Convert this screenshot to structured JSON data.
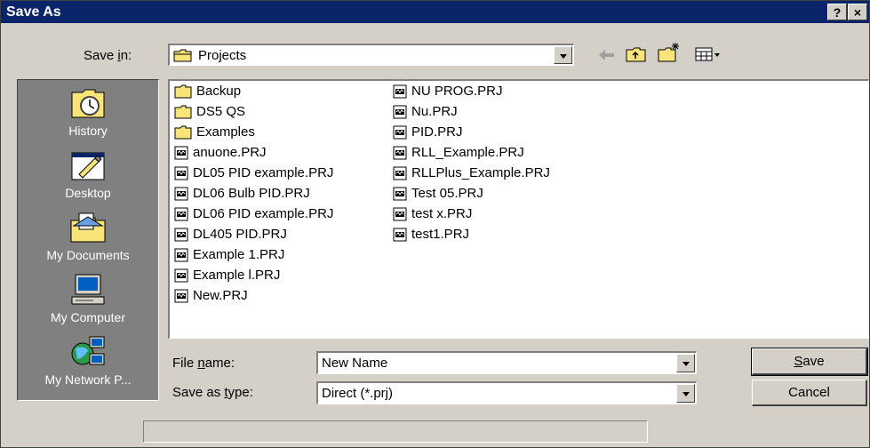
{
  "window": {
    "title": "Save As",
    "help_button": "?",
    "close_button": "×"
  },
  "save_in": {
    "label_pre": "Save ",
    "label_accel": "i",
    "label_post": "n:",
    "value": "Projects",
    "folder_icon": "folder-icon"
  },
  "toolbar": {
    "back_icon": "back-arrow-icon",
    "up_icon": "up-folder-icon",
    "new_folder_icon": "new-folder-icon",
    "view_menu_icon": "view-menu-icon"
  },
  "places": [
    {
      "label": "History",
      "icon": "history-icon"
    },
    {
      "label": "Desktop",
      "icon": "desktop-icon"
    },
    {
      "label": "My Documents",
      "icon": "my-documents-icon"
    },
    {
      "label": "My Computer",
      "icon": "my-computer-icon"
    },
    {
      "label": "My Network P...",
      "icon": "my-network-places-icon"
    }
  ],
  "files": {
    "col1": [
      {
        "name": "Backup",
        "type": "folder"
      },
      {
        "name": "DS5 QS",
        "type": "folder"
      },
      {
        "name": "Examples",
        "type": "folder"
      },
      {
        "name": "anuone.PRJ",
        "type": "prj"
      },
      {
        "name": "DL05 PID example.PRJ",
        "type": "prj"
      },
      {
        "name": "DL06 Bulb PID.PRJ",
        "type": "prj"
      },
      {
        "name": "DL06 PID example.PRJ",
        "type": "prj"
      },
      {
        "name": "DL405 PID.PRJ",
        "type": "prj"
      },
      {
        "name": "Example 1.PRJ",
        "type": "prj"
      },
      {
        "name": "Example l.PRJ",
        "type": "prj"
      },
      {
        "name": "New.PRJ",
        "type": "prj"
      }
    ],
    "col2": [
      {
        "name": "NU PROG.PRJ",
        "type": "prj"
      },
      {
        "name": "Nu.PRJ",
        "type": "prj"
      },
      {
        "name": "PID.PRJ",
        "type": "prj"
      },
      {
        "name": "RLL_Example.PRJ",
        "type": "prj"
      },
      {
        "name": "RLLPlus_Example.PRJ",
        "type": "prj"
      },
      {
        "name": "Test 05.PRJ",
        "type": "prj"
      },
      {
        "name": "test x.PRJ",
        "type": "prj"
      },
      {
        "name": "test1.PRJ",
        "type": "prj"
      }
    ]
  },
  "file_name": {
    "label_pre": "File ",
    "label_accel": "n",
    "label_post": "ame:",
    "value": "New Name"
  },
  "save_as_type": {
    "label_pre": "Save as ",
    "label_accel": "t",
    "label_post": "ype:",
    "value": "Direct (*.prj)"
  },
  "buttons": {
    "save_accel": "S",
    "save_rest": "ave",
    "cancel": "Cancel"
  },
  "colors": {
    "titlebar": "#0a246a",
    "dialog_face": "#d4d0c8",
    "places_bar": "#808080",
    "folder_yellow": "#f8e478"
  }
}
